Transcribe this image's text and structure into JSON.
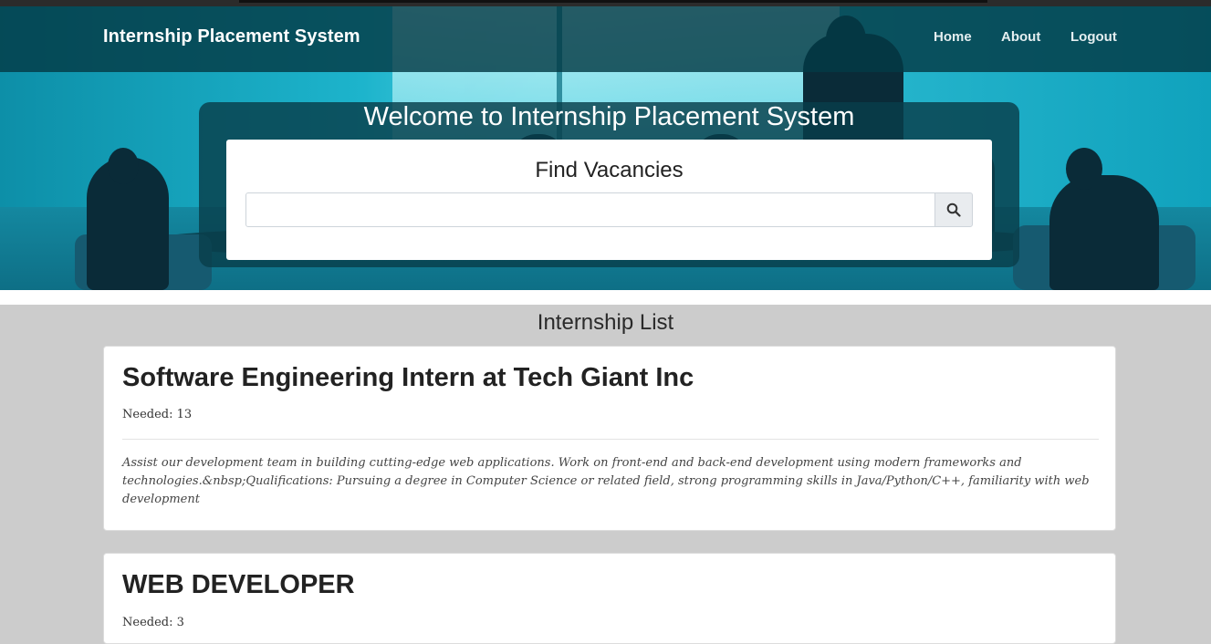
{
  "navbar": {
    "brand": "Internship Placement System",
    "links": [
      "Home",
      "About",
      "Logout"
    ]
  },
  "hero": {
    "welcome": "Welcome to Internship Placement System",
    "search": {
      "title": "Find Vacancies",
      "placeholder": "",
      "button_icon": "search-icon"
    }
  },
  "list": {
    "title": "Internship List",
    "jobs": [
      {
        "title": "Software Engineering Intern at Tech Giant Inc",
        "needed": "Needed: 13",
        "description": "Assist our development team in building cutting-edge web applications. Work on front-end and back-end development using modern frameworks and technologies.&nbsp;Qualifications: Pursuing a degree in Computer Science or related field, strong programming skills in Java/Python/C++, familiarity with web development"
      },
      {
        "title": "WEB DEVELOPER",
        "needed": "Needed: 3"
      }
    ]
  },
  "colors": {
    "navbar_bg": "#043a46",
    "hero_accent": "#1db4cc",
    "page_bg": "#cccccc"
  }
}
